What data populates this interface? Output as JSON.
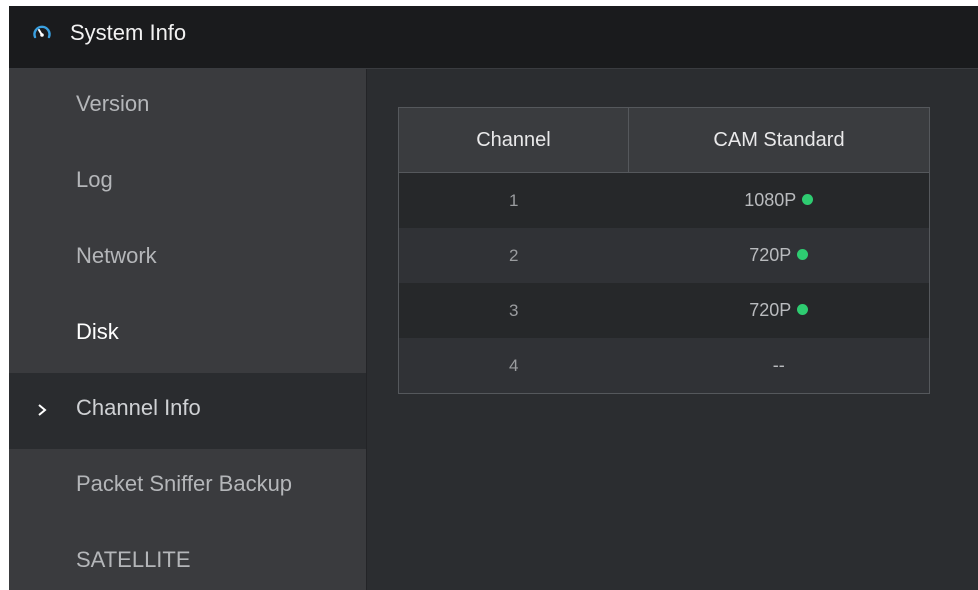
{
  "window": {
    "title": "System Info",
    "icon": "gauge-icon"
  },
  "sidebar": {
    "items": [
      {
        "label": "Version",
        "active": false
      },
      {
        "label": "Log",
        "active": false
      },
      {
        "label": "Network",
        "active": false
      },
      {
        "label": "Disk",
        "active": false
      },
      {
        "label": "Channel Info",
        "active": true
      },
      {
        "label": "Packet Sniffer Backup",
        "active": false
      },
      {
        "label": "SATELLITE",
        "active": false
      }
    ],
    "active_indicator_icon": "chevron-right-icon"
  },
  "channel_table": {
    "headers": {
      "channel": "Channel",
      "cam_standard": "CAM Standard"
    },
    "rows": [
      {
        "channel": "1",
        "cam_standard": "1080P",
        "status": "online"
      },
      {
        "channel": "2",
        "cam_standard": "720P",
        "status": "online"
      },
      {
        "channel": "3",
        "cam_standard": "720P",
        "status": "online"
      },
      {
        "channel": "4",
        "cam_standard": "--",
        "status": "none"
      }
    ]
  },
  "colors": {
    "status_online": "#2ecc71",
    "title_icon_accent": "#3aa0e0"
  }
}
